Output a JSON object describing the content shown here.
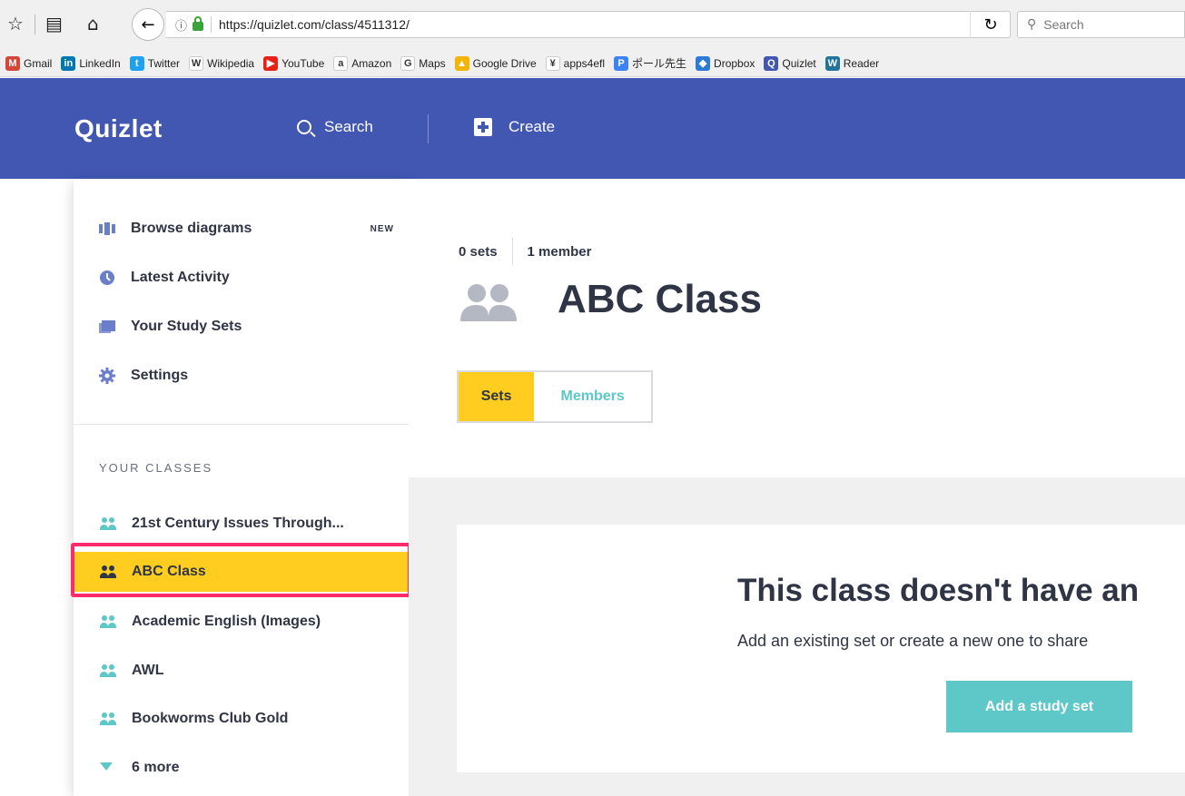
{
  "browser": {
    "url": "https://quizlet.com/class/4511312/",
    "search_placeholder": "Search"
  },
  "bookmarks": [
    {
      "label": "Gmail",
      "icon": "gmail-icon",
      "color": "#d44638",
      "glyph": "M"
    },
    {
      "label": "LinkedIn",
      "icon": "linkedin-icon",
      "color": "#0077b5",
      "glyph": "in"
    },
    {
      "label": "Twitter",
      "icon": "twitter-icon",
      "color": "#1da1f2",
      "glyph": "t"
    },
    {
      "label": "Wikipedia",
      "icon": "wikipedia-icon",
      "color": "#ffffff",
      "glyph": "W"
    },
    {
      "label": "YouTube",
      "icon": "youtube-icon",
      "color": "#e62117",
      "glyph": "▶"
    },
    {
      "label": "Amazon",
      "icon": "amazon-icon",
      "color": "#ffffff",
      "glyph": "a"
    },
    {
      "label": "Maps",
      "icon": "google-icon",
      "color": "#ffffff",
      "glyph": "G"
    },
    {
      "label": "Google Drive",
      "icon": "google-drive-icon",
      "color": "#f4b400",
      "glyph": "▲"
    },
    {
      "label": "apps4efl",
      "icon": "apps4efl-icon",
      "color": "#ffffff",
      "glyph": "¥"
    },
    {
      "label": "ポール先生",
      "icon": "p-icon",
      "color": "#3b82f6",
      "glyph": "P"
    },
    {
      "label": "Dropbox",
      "icon": "dropbox-icon",
      "color": "#2e7bd6",
      "glyph": "◆"
    },
    {
      "label": "Quizlet",
      "icon": "quizlet-icon",
      "color": "#4257b2",
      "glyph": "Q"
    },
    {
      "label": "Reader",
      "icon": "wordpress-icon",
      "color": "#21759b",
      "glyph": "W"
    }
  ],
  "header": {
    "logo": "Quizlet",
    "search_label": "Search",
    "create_label": "Create"
  },
  "sidebar": {
    "items": [
      {
        "label": "Browse diagrams",
        "badge": "NEW",
        "icon": "diagram-icon"
      },
      {
        "label": "Latest Activity",
        "icon": "clock-icon"
      },
      {
        "label": "Your Study Sets",
        "icon": "cards-icon"
      },
      {
        "label": "Settings",
        "icon": "gear-icon"
      }
    ],
    "classes_heading": "YOUR CLASSES",
    "classes": [
      {
        "label": "21st Century Issues Through..."
      },
      {
        "label": "ABC Class"
      },
      {
        "label": "Academic English (Images)"
      },
      {
        "label": "AWL"
      },
      {
        "label": "Bookworms Club Gold"
      }
    ],
    "more_label": "6 more"
  },
  "class": {
    "sets_count": "0 sets",
    "members_count": "1 member",
    "title": "ABC Class",
    "tabs": [
      "Sets",
      "Members"
    ]
  },
  "empty_state": {
    "title": "This class doesn't have an",
    "description": "Add an existing set or create a new one to share",
    "button": "Add a study set"
  },
  "colors": {
    "brand": "#4257b2",
    "accent_yellow": "#ffcd1f",
    "accent_teal": "#5ec7c7",
    "highlight": "#fe2a6c"
  }
}
